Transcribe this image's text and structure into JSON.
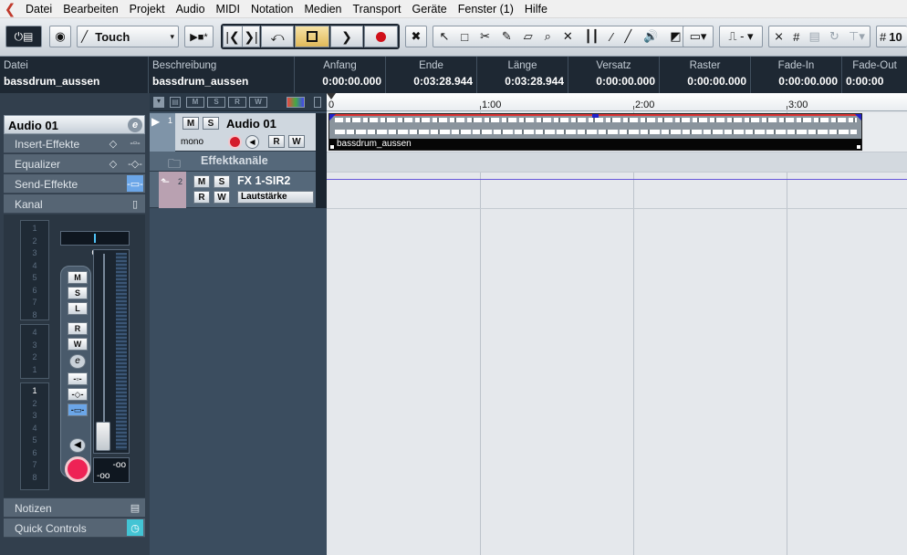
{
  "menu": {
    "items": [
      "Datei",
      "Bearbeiten",
      "Projekt",
      "Audio",
      "MIDI",
      "Notation",
      "Medien",
      "Transport",
      "Geräte",
      "Fenster (1)",
      "Hilfe"
    ]
  },
  "toolbar": {
    "automation_mode": "Touch",
    "grid_value": "10"
  },
  "infoline": {
    "datei_label": "Datei",
    "datei_value": "bassdrum_aussen",
    "beschreibung_label": "Beschreibung",
    "beschreibung_value": "bassdrum_aussen",
    "anfang_label": "Anfang",
    "anfang_value": "0:00:00.000",
    "ende_label": "Ende",
    "ende_value": "0:03:28.944",
    "laenge_label": "Länge",
    "laenge_value": "0:03:28.944",
    "versatz_label": "Versatz",
    "versatz_value": "0:00:00.000",
    "raster_label": "Raster",
    "raster_value": "0:00:00.000",
    "fadein_label": "Fade-In",
    "fadein_value": "0:00:00.000",
    "fadeout_label": "Fade-Out",
    "fadeout_value": "0:00:00"
  },
  "inspector": {
    "title": "Audio 01",
    "sections": [
      "Insert-Effekte",
      "Equalizer",
      "Send-Effekte",
      "Kanal"
    ],
    "bottom": [
      "Notizen",
      "Quick Controls"
    ],
    "pan": "C",
    "meter_top": "-oo",
    "meter_bottom": "-oo",
    "numbers_a": [
      "1",
      "2",
      "3",
      "4",
      "5",
      "6",
      "7",
      "8"
    ],
    "numbers_b": [
      "4",
      "3",
      "2",
      "1"
    ],
    "numbers_c": [
      "1",
      "2",
      "3",
      "4",
      "5",
      "6",
      "7",
      "8"
    ]
  },
  "tracks": {
    "audio": {
      "number": "1",
      "name": "Audio 01",
      "channel": "mono",
      "m": "M",
      "s": "S",
      "r": "R",
      "w": "W"
    },
    "folder": {
      "name": "Effektkanäle"
    },
    "fx": {
      "number": "2",
      "name": "FX 1-SIR2",
      "param": "Lautstärke",
      "m": "M",
      "s": "S",
      "r": "R",
      "w": "W"
    }
  },
  "ruler": {
    "labels": [
      "0",
      "1:00",
      "2:00",
      "3:00"
    ]
  },
  "event": {
    "name": "bassdrum_aussen"
  }
}
